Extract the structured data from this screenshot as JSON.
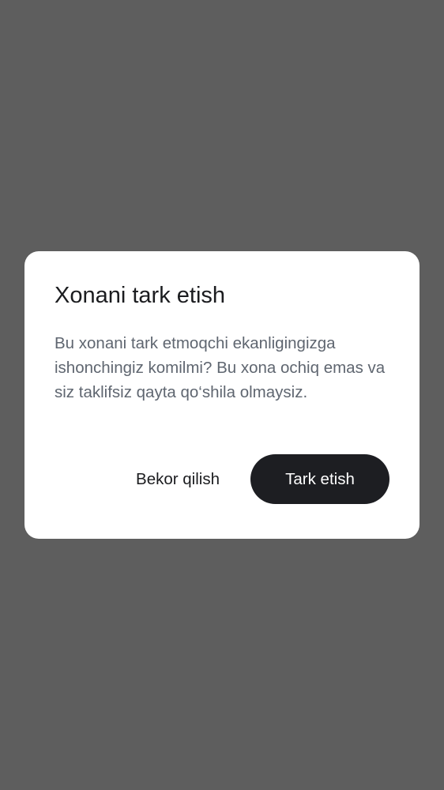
{
  "dialog": {
    "title": "Xonani tark etish",
    "message": "Bu xonani tark etmoqchi ekanligingizga ishonchingiz komilmi? Bu xona ochiq emas va siz taklifsiz qayta qo‘shila olmaysiz.",
    "cancel_label": "Bekor qilish",
    "confirm_label": "Tark etish"
  },
  "colors": {
    "backdrop": "#5e5e5e",
    "dialog_background": "#ffffff",
    "title_text": "#1b1c1f",
    "message_text": "#5f6670",
    "confirm_button": "#1d1e22",
    "confirm_text": "#ffffff"
  }
}
